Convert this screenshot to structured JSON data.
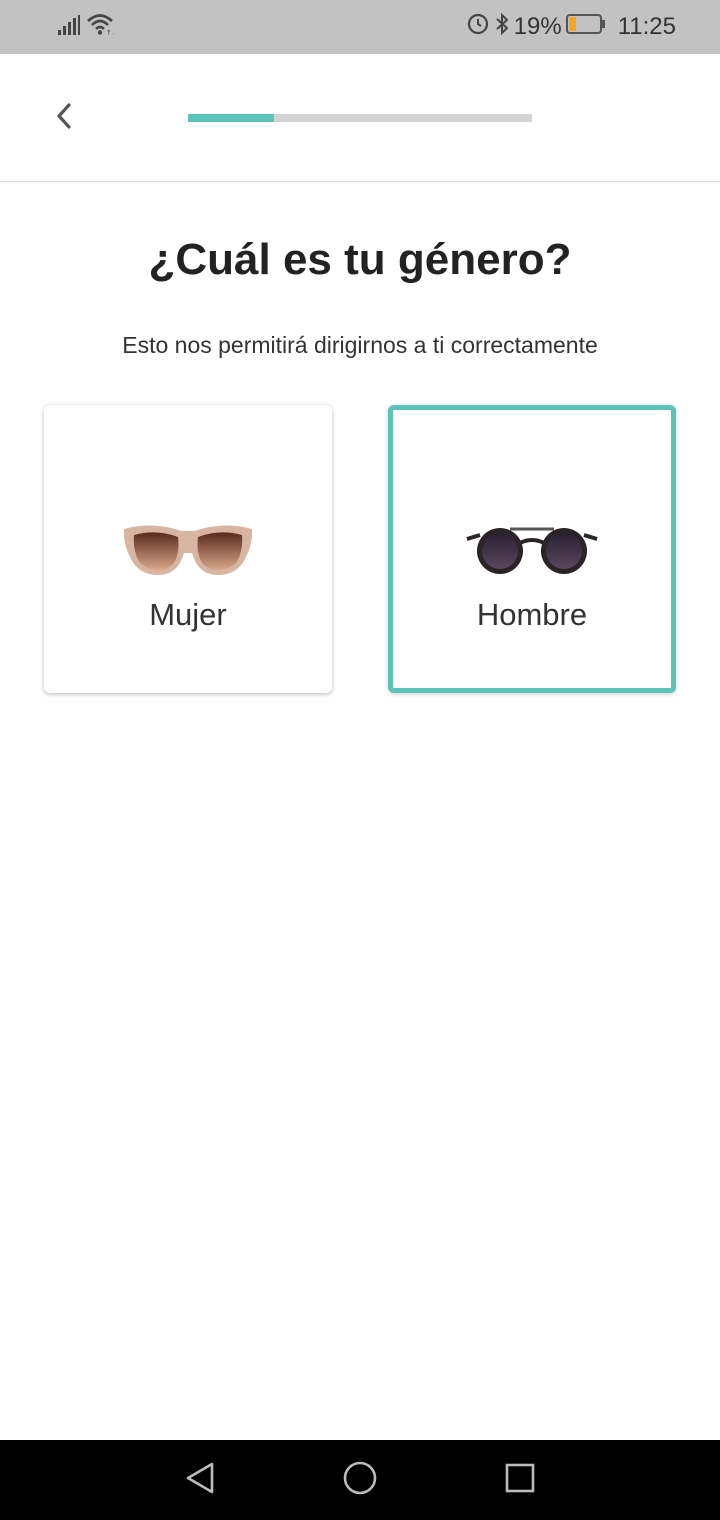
{
  "status_bar": {
    "battery_percent": "19%",
    "time": "11:25",
    "icons": [
      "signal-icon",
      "wifi-icon",
      "alarm-icon",
      "bluetooth-icon",
      "battery-icon"
    ],
    "battery_color": "#f5a623"
  },
  "header": {
    "back_icon": "chevron-left-icon",
    "progress": 0.25,
    "progress_color": "#5cc3ba",
    "track_color": "#d3d3d3"
  },
  "question": {
    "title": "¿Cuál es tu género?",
    "subtitle": "Esto nos permitirá dirigirnos a ti correctamente"
  },
  "options": [
    {
      "label": "Mujer",
      "icon": "cat-eye-sunglasses-icon",
      "selected": false
    },
    {
      "label": "Hombre",
      "icon": "round-sunglasses-icon",
      "selected": true
    }
  ],
  "accent_color": "#5cc3ba",
  "nav_bar": {
    "icons": [
      "back-triangle-icon",
      "home-circle-icon",
      "recents-square-icon"
    ]
  }
}
